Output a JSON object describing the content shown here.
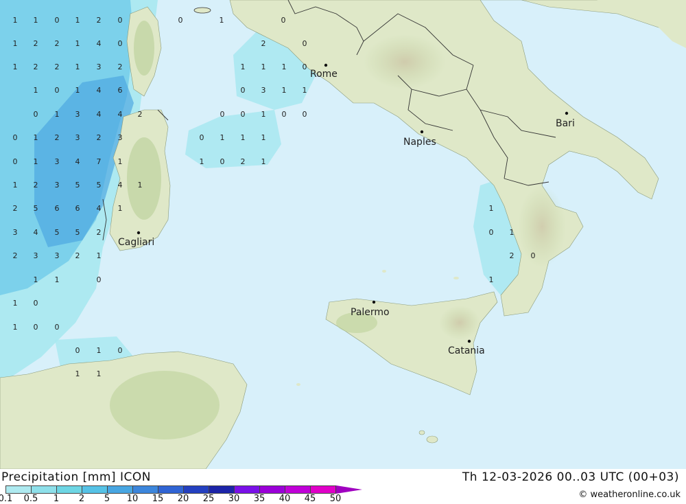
{
  "footer": {
    "title": "Precipitation [mm] ICON",
    "timestamp": "Th 12-03-2026 00..03 UTC (00+03)",
    "credit": "© weatheronline.co.uk"
  },
  "colors": {
    "sea": "#d8f0fa",
    "land": "#dfe8c8",
    "land_relief": "#b9cf98",
    "border": "#333333",
    "precip_light": "#a8e8f0",
    "precip_mid": "#6cc8e8",
    "precip_heavy": "#4aa4e0"
  },
  "legend": {
    "labels": [
      "0.1",
      "0.5",
      "1",
      "2",
      "5",
      "10",
      "15",
      "20",
      "25",
      "30",
      "35",
      "40",
      "45",
      "50"
    ],
    "colors": [
      "#aeeaf0",
      "#8ee0ea",
      "#6ed6e4",
      "#56c2e6",
      "#48a6e2",
      "#3c86dc",
      "#3064d4",
      "#2440c0",
      "#1c24a8",
      "#7a10e8",
      "#9a00d8",
      "#c000d8",
      "#e000c8",
      "#a000c0"
    ]
  },
  "cities": [
    {
      "name": "Rome",
      "marker": "city-dot"
    },
    {
      "name": "Naples",
      "marker": "city-dot"
    },
    {
      "name": "Bari",
      "marker": "city-dot"
    },
    {
      "name": "Cagliari",
      "marker": "city-dot"
    },
    {
      "name": "Palermo",
      "marker": "city-dot"
    },
    {
      "name": "Catania",
      "marker": "city-dot"
    }
  ],
  "precip_values": [
    "1",
    "1",
    "0",
    "1",
    "2",
    "0",
    "0",
    "1",
    "0",
    "1",
    "2",
    "2",
    "1",
    "4",
    "0",
    "2",
    "0",
    "1",
    "2",
    "2",
    "1",
    "3",
    "2",
    "1",
    "1",
    "1",
    "0",
    "1",
    "0",
    "1",
    "4",
    "6",
    "0",
    "3",
    "1",
    "1",
    "0",
    "1",
    "3",
    "4",
    "4",
    "2",
    "0",
    "0",
    "1",
    "0",
    "0",
    "0",
    "1",
    "2",
    "3",
    "2",
    "3",
    "0",
    "1",
    "1",
    "1",
    "0",
    "1",
    "3",
    "4",
    "7",
    "1",
    "1",
    "0",
    "2",
    "1",
    "1",
    "2",
    "3",
    "5",
    "5",
    "4",
    "1",
    "2",
    "5",
    "6",
    "6",
    "4",
    "1",
    "1",
    "3",
    "4",
    "5",
    "5",
    "2",
    "0",
    "1",
    "2",
    "3",
    "3",
    "2",
    "1",
    "2",
    "0",
    "1",
    "1",
    "0",
    "1",
    "1",
    "0",
    "1",
    "0",
    "0",
    "0",
    "1",
    "0",
    "1",
    "1"
  ]
}
